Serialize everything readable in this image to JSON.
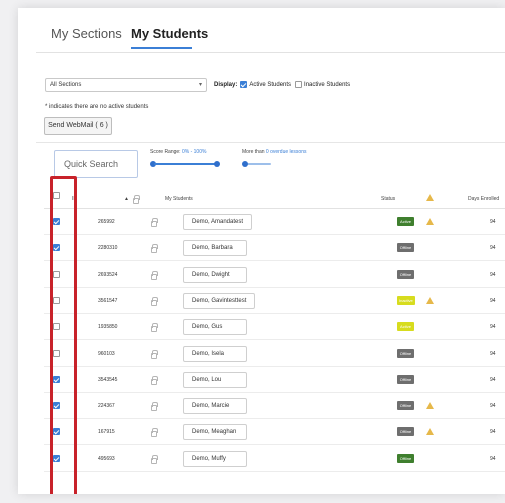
{
  "tabs": [
    {
      "label": "My Sections",
      "active": false
    },
    {
      "label": "My Students",
      "active": true
    }
  ],
  "filters": {
    "section_select": "All Sections",
    "display_label": "Display:",
    "active_students_label": "Active Students",
    "active_students_checked": true,
    "inactive_students_label": "Inactive Students",
    "inactive_students_checked": false,
    "note": "* indicates there are no active students"
  },
  "toolbar": {
    "webmail_button": "Send WebMail ( 6 )",
    "search_placeholder": "Quick Search",
    "score_range_label": "Score Range:",
    "score_range_value": "0% - 100%",
    "more_than_label": "More than",
    "more_than_value": "0 overdue lessons"
  },
  "columns": {
    "id": "ID",
    "students": "My Students",
    "status": "Status",
    "days": "Days Enrolled"
  },
  "colors": {
    "accent": "#3b7fd6",
    "active": "#3f7f2e",
    "offline": "#6e6e6e",
    "inactive": "#d7dc1e",
    "warning": "#e6b84a",
    "highlight": "#c8222a"
  },
  "rows": [
    {
      "checked": true,
      "id": "265992",
      "name": "Demo, Amandatest",
      "status": "Active",
      "status_kind": "active",
      "warning": true,
      "days": "94"
    },
    {
      "checked": true,
      "id": "2280310",
      "name": "Demo, Barbara",
      "status": "Offline",
      "status_kind": "offline",
      "warning": false,
      "days": "94"
    },
    {
      "checked": false,
      "id": "2693524",
      "name": "Demo, Dwight",
      "status": "Offline",
      "status_kind": "offline",
      "warning": false,
      "days": "94"
    },
    {
      "checked": false,
      "id": "3561547",
      "name": "Demo, Gavintesttest",
      "status": "Inactive",
      "status_kind": "inactive",
      "warning": true,
      "days": "94"
    },
    {
      "checked": false,
      "id": "1935850",
      "name": "Demo, Gus",
      "status": "Active",
      "status_kind": "inactive",
      "warning": false,
      "days": "94"
    },
    {
      "checked": false,
      "id": "960103",
      "name": "Demo, Isela",
      "status": "Offline",
      "status_kind": "offline",
      "warning": false,
      "days": "94"
    },
    {
      "checked": true,
      "id": "3543545",
      "name": "Demo, Lou",
      "status": "Offline",
      "status_kind": "offline",
      "warning": false,
      "days": "94"
    },
    {
      "checked": true,
      "id": "224367",
      "name": "Demo, Marcie",
      "status": "Offline",
      "status_kind": "offline",
      "warning": true,
      "days": "94"
    },
    {
      "checked": true,
      "id": "167915",
      "name": "Demo, Meaghan",
      "status": "Offline",
      "status_kind": "offline",
      "warning": true,
      "days": "94"
    },
    {
      "checked": true,
      "id": "495693",
      "name": "Demo, Muffy",
      "status": "Offline",
      "status_kind": "active",
      "warning": false,
      "days": "94"
    }
  ]
}
